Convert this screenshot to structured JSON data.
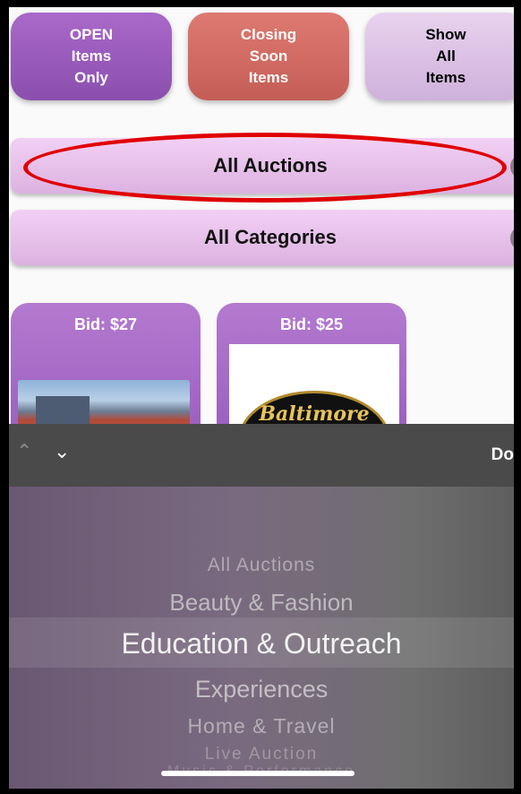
{
  "filters": {
    "open": "OPEN\nItems\nOnly",
    "closing": "Closing\nSoon\nItems",
    "show_all": "Show\nAll\nItems"
  },
  "dropdowns": {
    "auctions": "All Auctions",
    "categories": "All Categories"
  },
  "items": [
    {
      "bid": "Bid: $27"
    },
    {
      "bid": "Bid: $25",
      "logo_text": "Baltimore"
    }
  ],
  "picker": {
    "done_label": "Do",
    "options": [
      "All Auctions",
      "Beauty & Fashion",
      "Education & Outreach",
      "Experiences",
      "Home & Travel",
      "Live Auction",
      "Music & Performance"
    ],
    "selected_index": 2
  },
  "colors": {
    "accent_purple": "#9a5fbe",
    "closing_red": "#c45d55",
    "annotation_red": "#e00000"
  }
}
